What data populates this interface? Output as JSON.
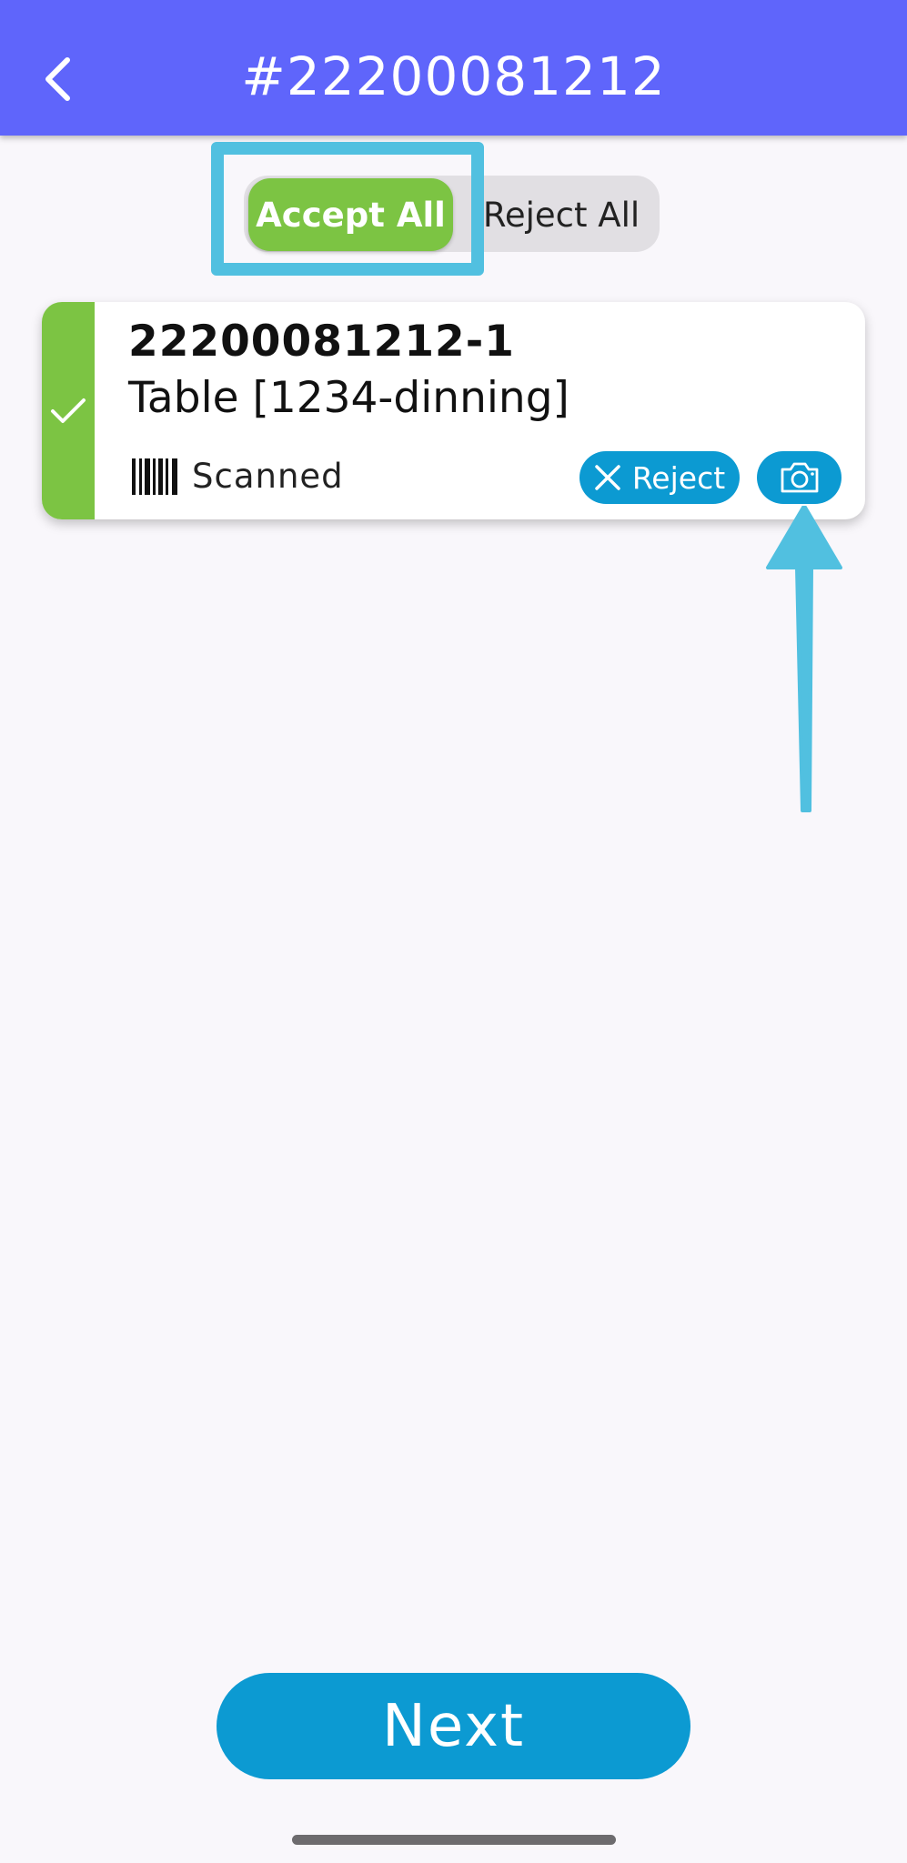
{
  "header": {
    "title": "#22200081212",
    "back_icon": "chevron-left-icon"
  },
  "actions": {
    "accept_all_label": "Accept All",
    "reject_all_label": "Reject All"
  },
  "items": [
    {
      "id": "22200081212-1",
      "name": "Table [1234-dinning]",
      "status_icon": "checkmark-icon",
      "scan_icon": "barcode-icon",
      "scan_status": "Scanned",
      "reject_label": "Reject",
      "reject_icon": "close-icon",
      "camera_icon": "camera-icon"
    }
  ],
  "footer": {
    "next_label": "Next"
  },
  "colors": {
    "header_bg": "#5f65fb",
    "accent_green": "#7cc443",
    "accent_blue": "#0c9ad2",
    "highlight_annotation": "#51c0e0",
    "page_bg": "#f9f7fb"
  }
}
